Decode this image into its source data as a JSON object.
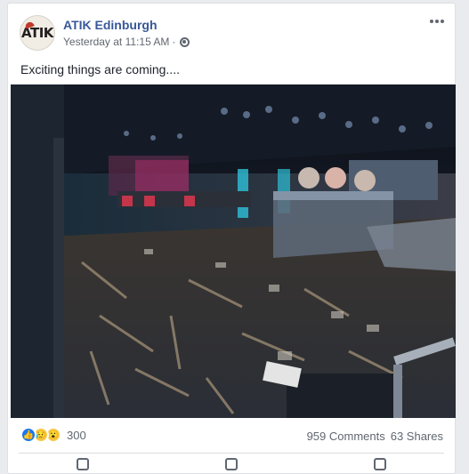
{
  "post": {
    "page_name": "ATIK Edinburgh",
    "avatar_text": "ATIK",
    "timestamp": "Yesterday at 11:15 AM",
    "separator": "·",
    "audience_icon": "globe-icon",
    "more_icon": "more-options-icon",
    "text": "Exciting things are coming....",
    "photo_description_icon": "post-photo"
  },
  "stats": {
    "reaction_icons": [
      "like-icon",
      "sad-icon",
      "wow-icon"
    ],
    "reaction_count": "300",
    "comments": "959 Comments",
    "shares": "63 Shares"
  },
  "colors": {
    "link": "#385898",
    "meta": "#616770",
    "like": "#1877f2"
  }
}
